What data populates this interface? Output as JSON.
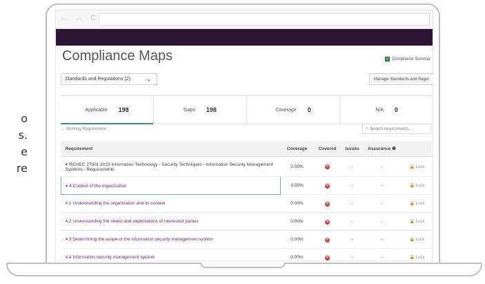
{
  "side_text": [
    "o",
    "s.",
    "e",
    "re"
  ],
  "browser": {
    "nav_icons": "← → C"
  },
  "page": {
    "title": "Compliance Maps",
    "compliance_summary": "Compliance Summar",
    "excel_icon": "X",
    "dropdown_value": "Standards and Regulations (2)",
    "manage_button": "Manage Standards and Regul",
    "working_requirement": "↔ Working Requirement",
    "search_placeholder": "Search requirements..."
  },
  "stats": [
    {
      "label": "Applicable",
      "value": "198"
    },
    {
      "label": "Gaps",
      "value": "198"
    },
    {
      "label": "Coverage",
      "value": "0"
    },
    {
      "label": "N/A",
      "value": "0"
    }
  ],
  "table": {
    "headers": [
      "Requirement",
      "Coverage",
      "Covered",
      "Issues",
      "Assurance ❶",
      ""
    ],
    "rows": [
      {
        "requirement": "ISO/IEC 27001:2013 Information Technology - Security Techniques - Information Security Management Systems - Requirements",
        "prefix": "▾",
        "coverage": "0.00%",
        "issues": "-",
        "assurance": "-",
        "lock": "🔒 Lock"
      },
      {
        "requirement": "4 Context of the organization",
        "prefix": "▾",
        "coverage": "0.00%",
        "issues": "-",
        "assurance": "-",
        "lock": "🔒 Lock"
      },
      {
        "requirement": "4.1 Understanding the organization and its context",
        "prefix": "",
        "coverage": "0.00%",
        "issues": "-",
        "assurance": "-",
        "lock": "🔒 Lock"
      },
      {
        "requirement": "4.2 Understanding the needs and expectations of interested parties",
        "prefix": "",
        "coverage": "0.00%",
        "issues": "-",
        "assurance": "-",
        "lock": "🔒 Lock"
      },
      {
        "requirement": "4.3 Determining the scope of the information security management system",
        "prefix": "",
        "coverage": "0.00%",
        "issues": "-",
        "assurance": "-",
        "lock": "🔒 Lock"
      },
      {
        "requirement": "4.4 Information security management system",
        "prefix": "",
        "coverage": "0.00%",
        "issues": "-",
        "assurance": "-",
        "lock": "🔒 Lock"
      }
    ]
  },
  "colors": {
    "topbar": "#2b1533",
    "accent_green": "#2f9a6e",
    "link_purple": "#7a2a7e",
    "error_red": "#d83b3b"
  }
}
